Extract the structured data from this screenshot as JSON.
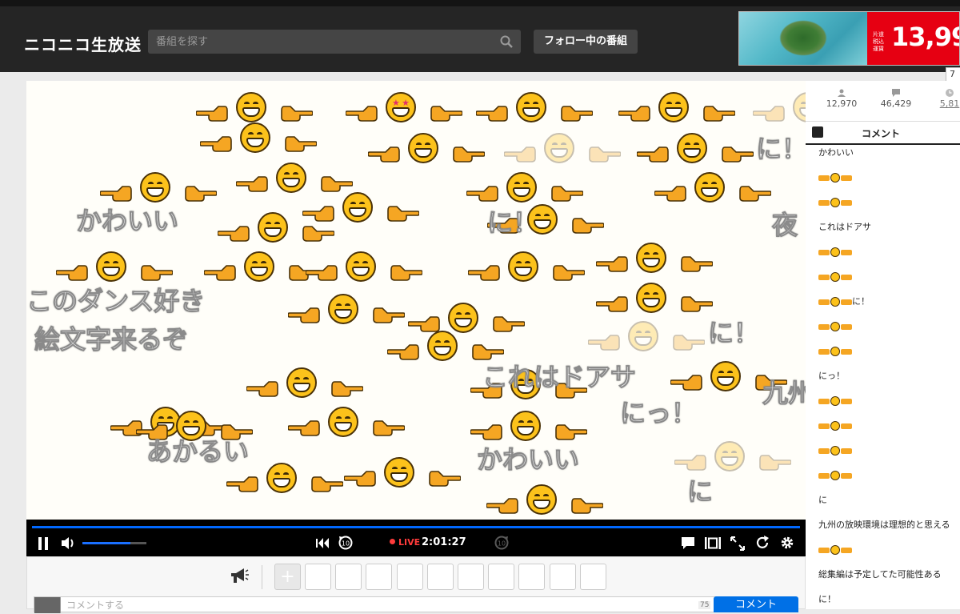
{
  "header": {
    "logo": "ニコニコ生放送",
    "search_placeholder": "番組を探す",
    "follow_label": "フォロー中の番組",
    "ad_price": "13,99",
    "ad_small": "片道 税込 運賃",
    "ad_tag": "7"
  },
  "overlay_comments": [
    {
      "text": "かわいい"
    },
    {
      "text": "このダンス好き"
    },
    {
      "text": "絵文字来るぞ"
    },
    {
      "text": "あかるい"
    },
    {
      "text": "に！"
    },
    {
      "text": "これはドアサ"
    },
    {
      "text": "にっ！"
    },
    {
      "text": "かわいい"
    },
    {
      "text": "に！"
    },
    {
      "text": "に"
    },
    {
      "text": "に！"
    },
    {
      "text": "夜"
    },
    {
      "text": "九州"
    }
  ],
  "controls": {
    "live_label": "LIVE",
    "elapsed": "2:01:27",
    "volume_level": 0.75
  },
  "comment_bar": {
    "placeholder": "コメントする",
    "char_count": "75",
    "submit_label": "コメント"
  },
  "side_panel": {
    "viewers": "12,970",
    "comments": "46,429",
    "timeshift": "5,81",
    "tab_label": "コメント",
    "comments_list": [
      {
        "text": "かわいい",
        "emoji": false
      },
      {
        "text": "",
        "emoji": true
      },
      {
        "text": "",
        "emoji": true
      },
      {
        "text": "これはドアサ",
        "emoji": false
      },
      {
        "text": "",
        "emoji": true
      },
      {
        "text": "",
        "emoji": true
      },
      {
        "text": "に！",
        "emoji": true
      },
      {
        "text": "",
        "emoji": true
      },
      {
        "text": "",
        "emoji": true
      },
      {
        "text": "にっ！",
        "emoji": false
      },
      {
        "text": "",
        "emoji": true
      },
      {
        "text": "",
        "emoji": true
      },
      {
        "text": "",
        "emoji": true
      },
      {
        "text": "",
        "emoji": true
      },
      {
        "text": "に",
        "emoji": false
      },
      {
        "text": "九州の放映環境は理想的と思える",
        "emoji": false
      },
      {
        "text": "",
        "emoji": true
      },
      {
        "text": "総集編は予定してた可能性ある",
        "emoji": false
      },
      {
        "text": "に！",
        "emoji": false
      }
    ]
  },
  "colors": {
    "accent": "#0068ff",
    "live": "#ff3b3b",
    "emoji": "#fcc21b",
    "submit": "#0070e6"
  }
}
